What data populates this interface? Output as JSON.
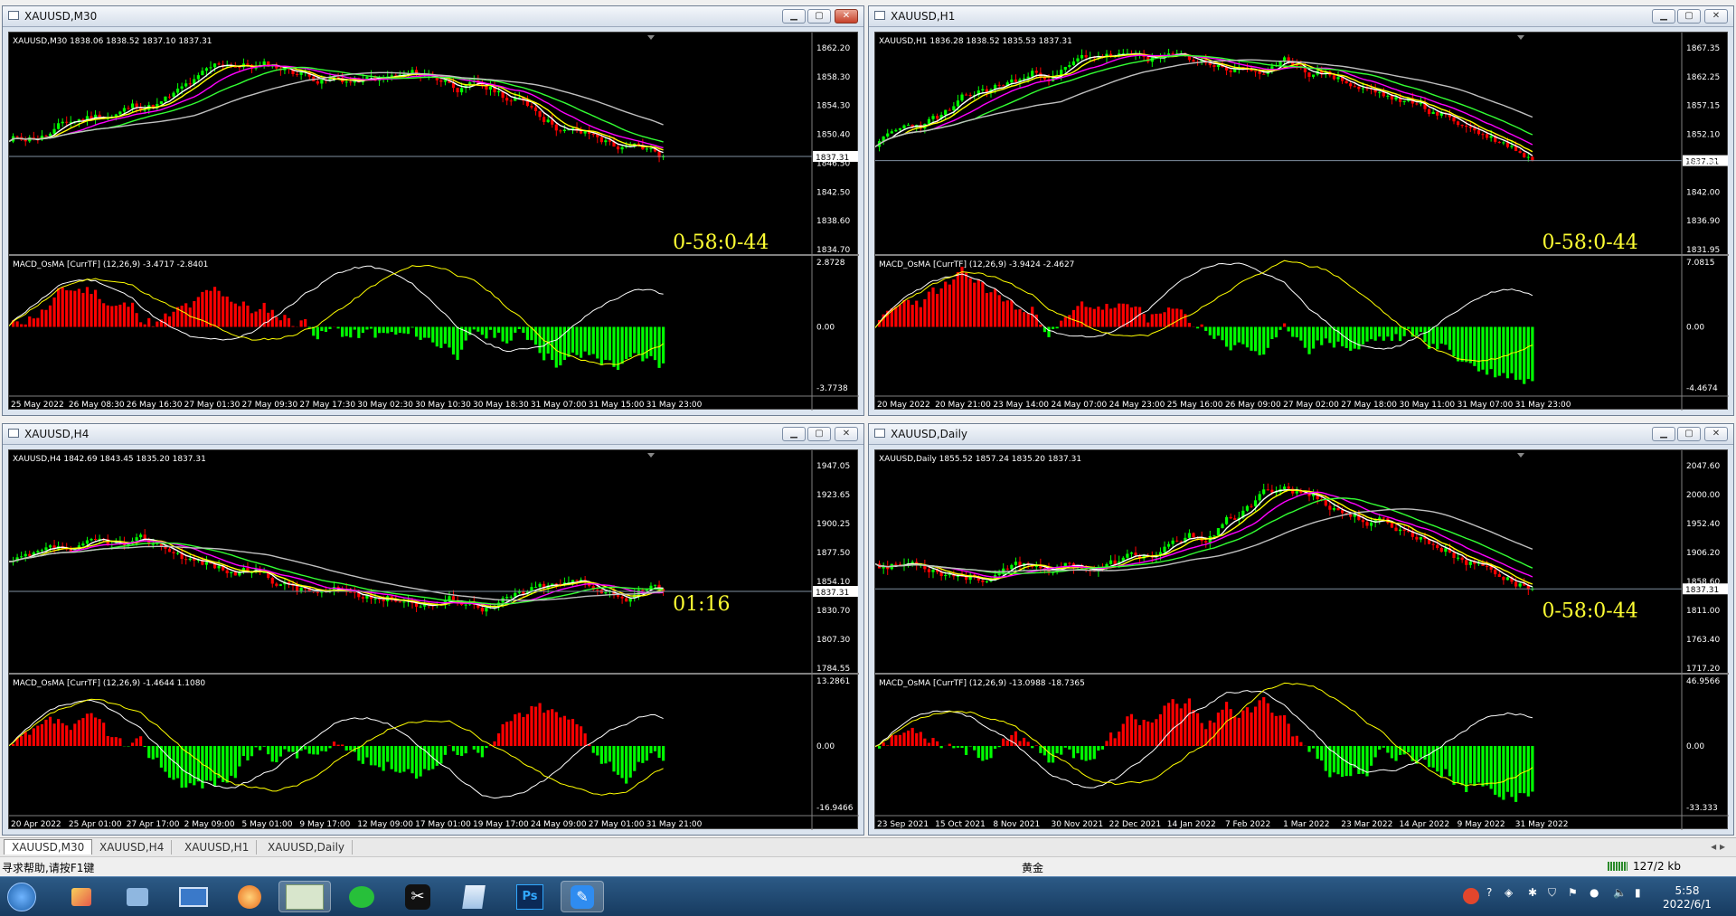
{
  "windows": [
    {
      "id": "w1",
      "title": "XAUUSD,M30",
      "symbol_line": "XAUUSD,M30  1838.06 1838.52 1837.10 1837.31",
      "price_labels": [
        "1862.20",
        "1858.30",
        "1854.30",
        "1850.40",
        "1846.50",
        "1842.50",
        "1838.60",
        "1834.70"
      ],
      "current_price": "1837.31",
      "macd_line": "MACD_OsMA [CurrTF] (12,26,9) -3.4717 -2.8401",
      "macd_labels": [
        "2.8728",
        "0.00",
        "-3.7738"
      ],
      "x_labels": [
        "25 May 2022",
        "26 May 08:30",
        "26 May 16:30",
        "27 May 01:30",
        "27 May 09:30",
        "27 May 17:30",
        "30 May 02:30",
        "30 May 10:30",
        "30 May 18:30",
        "31 May 07:00",
        "31 May 15:00",
        "31 May 23:00"
      ],
      "timer": "0-58:0-44",
      "close_red": true,
      "seed": 11,
      "trend": "up-then-down"
    },
    {
      "id": "w2",
      "title": "XAUUSD,H1",
      "symbol_line": "XAUUSD,H1  1836.28 1838.52 1835.53 1837.31",
      "price_labels": [
        "1867.35",
        "1862.25",
        "1857.15",
        "1852.10",
        "1847.10",
        "1842.00",
        "1836.90",
        "1831.95"
      ],
      "current_price": "1837.31",
      "macd_line": "MACD_OsMA [CurrTF] (12,26,9) -3.9424 -2.4627",
      "macd_labels": [
        "7.0815",
        "0.00",
        "-4.4674"
      ],
      "x_labels": [
        "20 May 2022",
        "20 May 21:00",
        "23 May 14:00",
        "24 May 07:00",
        "24 May 23:00",
        "25 May 16:00",
        "26 May 09:00",
        "27 May 02:00",
        "27 May 18:00",
        "30 May 11:00",
        "31 May 07:00",
        "31 May 23:00"
      ],
      "timer": "0-58:0-44",
      "close_red": false,
      "seed": 23,
      "trend": "up-then-down"
    },
    {
      "id": "w3",
      "title": "XAUUSD,H4",
      "symbol_line": "XAUUSD,H4  1842.69 1843.45 1835.20 1837.31",
      "price_labels": [
        "1947.05",
        "1923.65",
        "1900.25",
        "1877.50",
        "1854.10",
        "1830.70",
        "1807.30",
        "1784.55"
      ],
      "current_price": "1837.31",
      "macd_line": "MACD_OsMA [CurrTF] (12,26,9) -1.4644 1.1080",
      "macd_labels": [
        "13.2861",
        "0.00",
        "-16.9466"
      ],
      "x_labels": [
        "20 Apr 2022",
        "25 Apr 01:00",
        "27 Apr 17:00",
        "2 May 09:00",
        "5 May 01:00",
        "9 May 17:00",
        "12 May 09:00",
        "17 May 01:00",
        "19 May 17:00",
        "24 May 09:00",
        "27 May 01:00",
        "31 May 21:00"
      ],
      "timer": "01:16",
      "close_red": false,
      "seed": 37,
      "trend": "down-then-flat"
    },
    {
      "id": "w4",
      "title": "XAUUSD,Daily",
      "symbol_line": "XAUUSD,Daily  1855.52 1857.24 1835.20 1837.31",
      "price_labels": [
        "2047.60",
        "2000.00",
        "1952.40",
        "1906.20",
        "1858.60",
        "1811.00",
        "1763.40",
        "1717.20"
      ],
      "current_price": "1837.31",
      "macd_line": "MACD_OsMA [CurrTF] (12,26,9) -13.0988 -18.7365",
      "macd_labels": [
        "46.9566",
        "0.00",
        "-33.333"
      ],
      "x_labels": [
        "23 Sep 2021",
        "15 Oct 2021",
        "8 Nov 2021",
        "30 Nov 2021",
        "22 Dec 2021",
        "14 Jan 2022",
        "7 Feb 2022",
        "1 Mar 2022",
        "23 Mar 2022",
        "14 Apr 2022",
        "9 May 2022",
        "31 May 2022"
      ],
      "timer": "0-58:0-44",
      "close_red": false,
      "seed": 53,
      "trend": "flat-peak-down"
    }
  ],
  "tabs": [
    "XAUUSD,M30",
    "XAUUSD,H4",
    "XAUUSD,H1",
    "XAUUSD,Daily"
  ],
  "status": {
    "help": "寻求帮助,请按F1键",
    "instrument": "黄金",
    "traffic": "127/2 kb"
  },
  "clock": {
    "time": "5:58",
    "date": "2022/6/1"
  },
  "colors": {
    "bull": "#00ff00",
    "bear": "#ff0000",
    "ma_fast": "#ffffff",
    "ma_yellow": "#ffff00",
    "ma_magenta": "#ff00ff",
    "ma_green": "#33ff33",
    "ma_gray": "#c0c0c0",
    "timer": "#ffff33"
  },
  "taskbar_icons": [
    "start-orb-icon",
    "paint-icon",
    "contacts-icon",
    "desktop-icon",
    "browser-icon",
    "metatrader-icon",
    "wechat-icon",
    "capcut-icon",
    "notes-icon",
    "photoshop-icon",
    "edit-icon"
  ]
}
